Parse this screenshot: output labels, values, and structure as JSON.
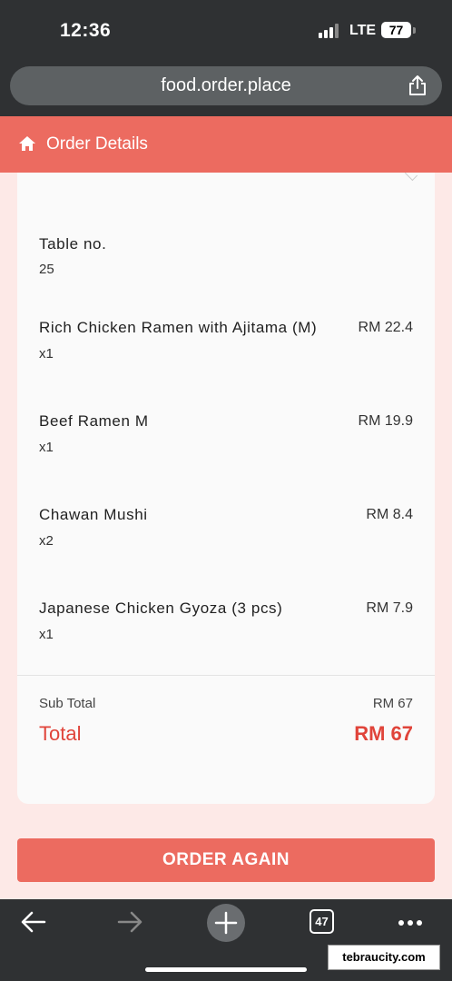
{
  "status_bar": {
    "time": "12:36",
    "network": "LTE",
    "battery": "77"
  },
  "browser": {
    "url": "food.order.place",
    "tab_count": "47"
  },
  "header": {
    "title": "Order Details"
  },
  "order": {
    "table_label": "Table no.",
    "table_number": "25",
    "items": [
      {
        "name": "Rich Chicken Ramen with Ajitama (M)",
        "qty": "x1",
        "price": "RM 22.4"
      },
      {
        "name": "Beef Ramen M",
        "qty": "x1",
        "price": "RM 19.9"
      },
      {
        "name": "Chawan Mushi",
        "qty": "x2",
        "price": "RM 8.4"
      },
      {
        "name": "Japanese Chicken Gyoza (3 pcs)",
        "qty": "x1",
        "price": "RM 7.9"
      }
    ],
    "subtotal_label": "Sub Total",
    "subtotal_value": "RM 67",
    "total_label": "Total",
    "total_value": "RM 67"
  },
  "actions": {
    "order_again": "ORDER AGAIN"
  },
  "watermark": "tebraucity.com",
  "colors": {
    "accent": "#ec6b60",
    "total": "#e0443a",
    "chrome": "#2f3133",
    "background": "#fde9e7"
  }
}
